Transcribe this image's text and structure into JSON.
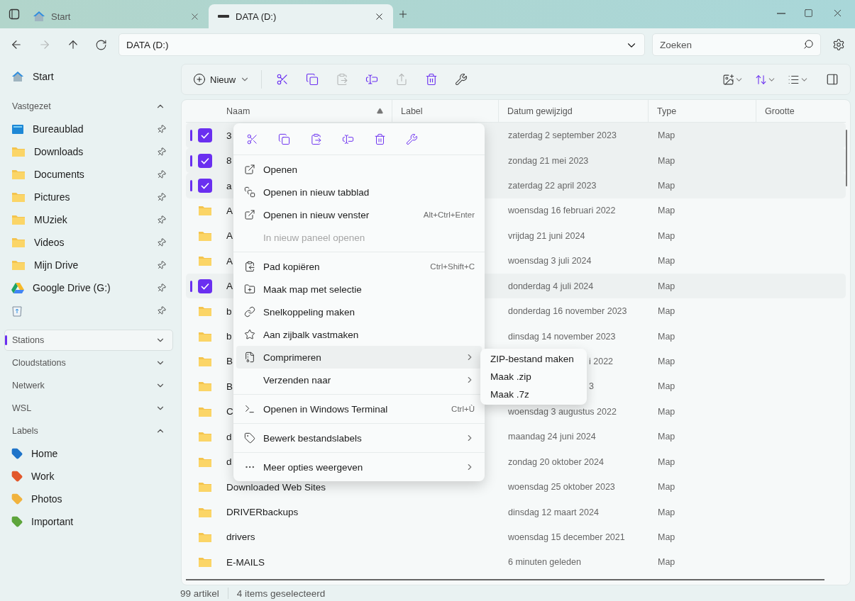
{
  "tabs": [
    {
      "label": "Start",
      "selected": false,
      "kind": "home"
    },
    {
      "label": "DATA (D:)",
      "selected": true,
      "kind": "drive"
    }
  ],
  "address": {
    "value": "DATA (D:)"
  },
  "search": {
    "placeholder": "Zoeken"
  },
  "toolbar": {
    "new_label": "Nieuw",
    "actions": [
      {
        "disabled": false
      },
      {
        "disabled": false
      },
      {
        "disabled": true
      },
      {
        "disabled": false
      },
      {
        "disabled": true
      },
      {
        "disabled": false
      },
      {
        "disabled": false
      }
    ]
  },
  "sidebar": {
    "home": "Start",
    "pinned_title": "Vastgezet",
    "pinned_expanded": true,
    "pinned": [
      {
        "label": "Bureaublad",
        "kind": "desktop"
      },
      {
        "label": "Downloads",
        "kind": "folder"
      },
      {
        "label": "Documents",
        "kind": "folder"
      },
      {
        "label": "Pictures",
        "kind": "folder"
      },
      {
        "label": "MUziek",
        "kind": "folder"
      },
      {
        "label": "Videos",
        "kind": "folder"
      },
      {
        "label": "Mijn Drive",
        "kind": "folder"
      },
      {
        "label": "Google Drive (G:)",
        "kind": "gdrive"
      },
      {
        "kind": "recycle"
      }
    ],
    "sections": [
      {
        "label": "Stations",
        "expanded": false,
        "selected": true
      },
      {
        "label": "Cloudstations",
        "expanded": false,
        "selected": false
      },
      {
        "label": "Netwerk",
        "expanded": false,
        "selected": false
      },
      {
        "label": "WSL",
        "expanded": false,
        "selected": false
      },
      {
        "label": "Labels",
        "expanded": true,
        "selected": false,
        "children": [
          {
            "label": "Home",
            "color": "#1f74c9"
          },
          {
            "label": "Work",
            "color": "#e2582c"
          },
          {
            "label": "Photos",
            "color": "#f1b33e"
          },
          {
            "label": "Important",
            "color": "#5ea53c"
          }
        ]
      }
    ]
  },
  "table": {
    "columns": [
      {
        "label": "Naam",
        "sorted": true
      },
      {
        "label": "Label",
        "sorted": false
      },
      {
        "label": "Datum gewijzigd",
        "sorted": false
      },
      {
        "label": "Type",
        "sorted": false
      },
      {
        "label": "Grootte",
        "sorted": false
      }
    ],
    "rows": [
      {
        "name": "3",
        "date": "zaterdag 2 september 2023",
        "type": "Map",
        "selected": true,
        "date_covered": false
      },
      {
        "name": "8",
        "date": "zondag 21 mei 2023",
        "type": "Map",
        "selected": true,
        "date_covered": false
      },
      {
        "name": "a",
        "date": "zaterdag 22 april 2023",
        "type": "Map",
        "selected": true,
        "date_covered": false
      },
      {
        "name": "A",
        "date": "woensdag 16 februari 2022",
        "type": "Map",
        "selected": false,
        "date_covered": false
      },
      {
        "name": "A",
        "date": "vrijdag 21 juni 2024",
        "type": "Map",
        "selected": false,
        "date_covered": false
      },
      {
        "name": "A",
        "date": "woensdag 3 juli 2024",
        "type": "Map",
        "selected": false,
        "date_covered": false
      },
      {
        "name": "A",
        "date": "donderdag 4 juli 2024",
        "type": "Map",
        "selected": true,
        "date_covered": false
      },
      {
        "name": "b",
        "date": "donderdag 16 november 2023",
        "type": "Map",
        "selected": false,
        "date_covered": false
      },
      {
        "name": "b",
        "date": "dinsdag 14 november 2023",
        "type": "Map",
        "selected": false,
        "date_covered": false
      },
      {
        "name": "B",
        "date": "i 2022",
        "type": "Map",
        "selected": false,
        "date_covered": true
      },
      {
        "name": "B",
        "date": "3",
        "type": "Map",
        "selected": false,
        "date_covered": true
      },
      {
        "name": "C",
        "date": "woensdag 3 augustus 2022",
        "type": "Map",
        "selected": false,
        "date_covered": false
      },
      {
        "name": "d",
        "date": "maandag 24 juni 2024",
        "type": "Map",
        "selected": false,
        "date_covered": false
      },
      {
        "name": "d",
        "date": "zondag 20 oktober 2024",
        "type": "Map",
        "selected": false,
        "date_covered": false
      },
      {
        "name": "Downloaded Web Sites",
        "date": "woensdag 25 oktober 2023",
        "type": "Map",
        "selected": false,
        "date_covered": false
      },
      {
        "name": "DRIVERbackups",
        "date": "dinsdag 12 maart 2024",
        "type": "Map",
        "selected": false,
        "date_covered": false
      },
      {
        "name": "drivers",
        "date": "woensdag 15 december 2021",
        "type": "Map",
        "selected": false,
        "date_covered": false
      },
      {
        "name": "E-MAILS",
        "date": "6 minuten geleden",
        "type": "Map",
        "selected": false,
        "date_covered": false
      }
    ]
  },
  "context_menu": {
    "items": [
      {
        "kind": "item",
        "label": "Openen",
        "disabled": false,
        "selected": false,
        "submenu": false
      },
      {
        "kind": "item",
        "label": "Openen in nieuw tabblad",
        "disabled": false,
        "selected": false,
        "submenu": false
      },
      {
        "kind": "item",
        "label": "Openen in nieuw venster",
        "shortcut": "Alt+Ctrl+Enter",
        "disabled": false,
        "selected": false,
        "submenu": false
      },
      {
        "kind": "item",
        "label": "In nieuw paneel openen",
        "disabled": true,
        "selected": false,
        "submenu": false
      },
      {
        "kind": "separator"
      },
      {
        "kind": "item",
        "label": "Pad kopiëren",
        "shortcut": "Ctrl+Shift+C",
        "disabled": false,
        "selected": false,
        "submenu": false
      },
      {
        "kind": "item",
        "label": "Maak map met selectie",
        "disabled": false,
        "selected": false,
        "submenu": false
      },
      {
        "kind": "item",
        "label": "Snelkoppeling maken",
        "disabled": false,
        "selected": false,
        "submenu": false
      },
      {
        "kind": "item",
        "label": "Aan zijbalk vastmaken",
        "disabled": false,
        "selected": false,
        "submenu": false
      },
      {
        "kind": "item",
        "label": "Comprimeren",
        "disabled": false,
        "selected": true,
        "submenu": true
      },
      {
        "kind": "item",
        "label": "Verzenden naar",
        "disabled": false,
        "selected": false,
        "submenu": true
      },
      {
        "kind": "separator"
      },
      {
        "kind": "item",
        "label": "Openen in Windows Terminal",
        "shortcut": "Ctrl+Ù",
        "disabled": false,
        "selected": false,
        "submenu": false
      },
      {
        "kind": "separator"
      },
      {
        "kind": "item",
        "label": "Bewerk bestandslabels",
        "disabled": false,
        "selected": false,
        "submenu": true
      },
      {
        "kind": "separator"
      },
      {
        "kind": "item",
        "label": "Meer opties weergeven",
        "disabled": false,
        "selected": false,
        "submenu": true
      }
    ]
  },
  "submenu": {
    "items": [
      "ZIP-bestand maken",
      "Maak .zip",
      "Maak .7z"
    ]
  },
  "status_bar": {
    "count": "99 artikel",
    "selection": "4 items geselecteerd"
  }
}
